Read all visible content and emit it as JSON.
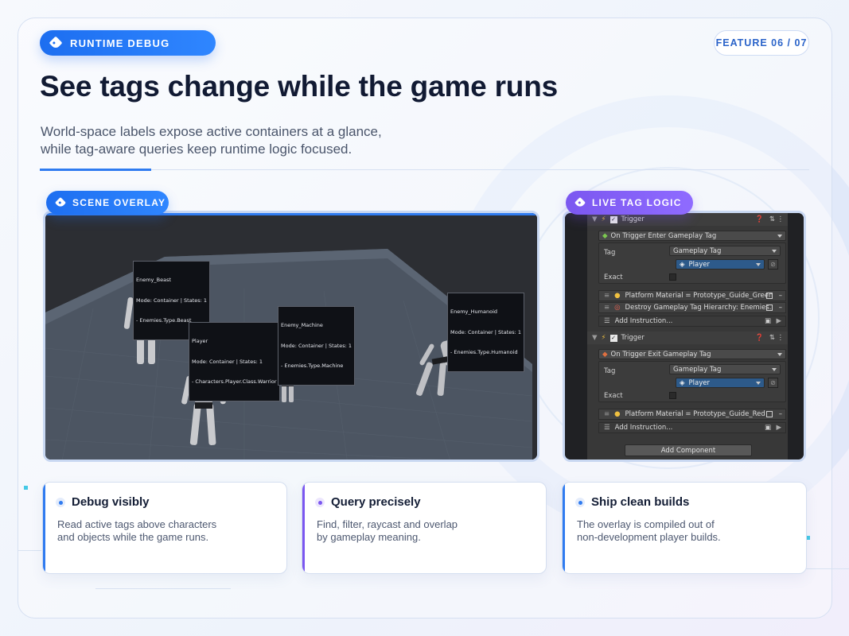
{
  "badge": {
    "label": "RUNTIME DEBUG"
  },
  "feature_counter": "FEATURE 06 / 07",
  "title": "See tags change while the game runs",
  "subtitle_line1": "World-space labels expose active containers at a glance,",
  "subtitle_line2": "while tag-aware queries keep runtime logic focused.",
  "scene": {
    "badge": "SCENE OVERLAY",
    "labels": [
      {
        "name": "Enemy_Beast",
        "mode": "Mode: Container | States: 1",
        "tag": "- Enemies.Type.Beast"
      },
      {
        "name": "Player",
        "mode": "Mode: Container | States: 1",
        "tag": "- Characters.Player.Class.Warrior"
      },
      {
        "name": "Enemy_Machine",
        "mode": "Mode: Container | States: 1",
        "tag": "- Enemies.Type.Machine"
      },
      {
        "name": "Enemy_Humanoid",
        "mode": "Mode: Container | States: 1",
        "tag": "- Enemies.Type.Humanoid"
      }
    ]
  },
  "inspector": {
    "badge": "LIVE TAG LOGIC",
    "trigger1": {
      "header": "Trigger",
      "event": "On Trigger Enter Gameplay Tag",
      "tag_label": "Tag",
      "tag_type": "Gameplay Tag",
      "tag_value": "Player",
      "exact_label": "Exact",
      "instructions": [
        "Platform Material = Prototype_Guide_Green",
        "Destroy Gameplay Tag Hierarchy: Enemies."
      ],
      "add_instruction": "Add Instruction..."
    },
    "trigger2": {
      "header": "Trigger",
      "event": "On Trigger Exit Gameplay Tag",
      "tag_label": "Tag",
      "tag_type": "Gameplay Tag",
      "tag_value": "Player",
      "exact_label": "Exact",
      "instructions": [
        "Platform Material = Prototype_Guide_Red"
      ],
      "add_instruction": "Add Instruction..."
    },
    "add_component": "Add Component"
  },
  "cards": [
    {
      "title": "Debug visibly",
      "body1": "Read active tags above characters",
      "body2": "and objects while the game runs.",
      "accent": "#2f7bf0"
    },
    {
      "title": "Query precisely",
      "body1": "Find, filter, raycast and overlap",
      "body2": "by gameplay meaning.",
      "accent": "#7b57f0"
    },
    {
      "title": "Ship clean builds",
      "body1": "The overlay is compiled out of",
      "body2": "non-development player builds.",
      "accent": "#2f7bf0"
    }
  ],
  "colors": {
    "accent_blue": "#2f7bf0",
    "accent_purple": "#7b57f0",
    "title": "#111a33"
  }
}
